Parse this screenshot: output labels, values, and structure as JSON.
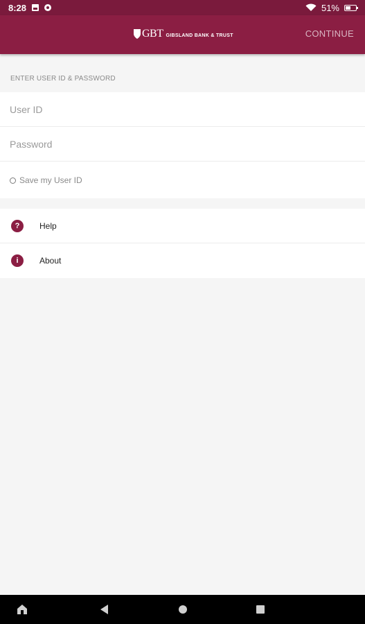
{
  "status_bar": {
    "time": "8:28",
    "battery_text": "51%",
    "icons": [
      "image-icon",
      "record-icon",
      "wifi-icon",
      "battery-icon"
    ]
  },
  "app_bar": {
    "logo_mark": "GBT",
    "logo_name": "GIBSLAND BANK & TRUST",
    "continue_label": "CONTINUE",
    "brand_color": "#8b1e43",
    "continue_color": "#d9b6c3"
  },
  "login": {
    "section_header": "ENTER USER ID & PASSWORD",
    "user_id_placeholder": "User ID",
    "user_id_value": "",
    "password_placeholder": "Password",
    "password_value": "",
    "save_user_id_label": "Save my User ID",
    "save_user_id_checked": false
  },
  "menu": {
    "items": [
      {
        "label": "Help",
        "icon": "help-icon",
        "glyph": "?"
      },
      {
        "label": "About",
        "icon": "info-icon",
        "glyph": "i"
      }
    ]
  },
  "nav_bar": {
    "icons": [
      "home-icon",
      "back-icon",
      "home-circle-icon",
      "recents-icon"
    ]
  }
}
